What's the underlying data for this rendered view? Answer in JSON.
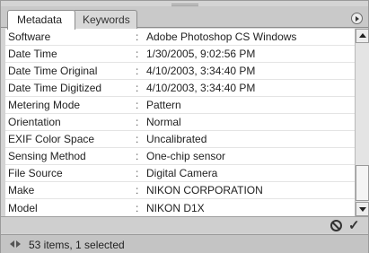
{
  "tabs": [
    {
      "label": "Metadata",
      "active": true
    },
    {
      "label": "Keywords",
      "active": false
    }
  ],
  "metadata_rows": [
    {
      "label": "Software",
      "value": "Adobe Photoshop CS Windows"
    },
    {
      "label": "Date Time",
      "value": "1/30/2005, 9:02:56 PM"
    },
    {
      "label": "Date Time Original",
      "value": "4/10/2003, 3:34:40 PM"
    },
    {
      "label": "Date Time Digitized",
      "value": "4/10/2003, 3:34:40 PM"
    },
    {
      "label": "Metering Mode",
      "value": "Pattern"
    },
    {
      "label": "Orientation",
      "value": "Normal"
    },
    {
      "label": "EXIF Color Space",
      "value": "Uncalibrated"
    },
    {
      "label": "Sensing Method",
      "value": "One-chip sensor"
    },
    {
      "label": "File Source",
      "value": "Digital Camera"
    },
    {
      "label": "Make",
      "value": "NIKON CORPORATION"
    },
    {
      "label": "Model",
      "value": "NIKON D1X"
    }
  ],
  "separator": ":",
  "status": {
    "text": "53 items, 1 selected"
  },
  "icons": {
    "panel_menu": "panel-menu-icon",
    "cancel": "cancel-icon",
    "apply": "checkmark-icon",
    "nav": "navigate-arrows-icon"
  },
  "apply_glyph": "✓"
}
